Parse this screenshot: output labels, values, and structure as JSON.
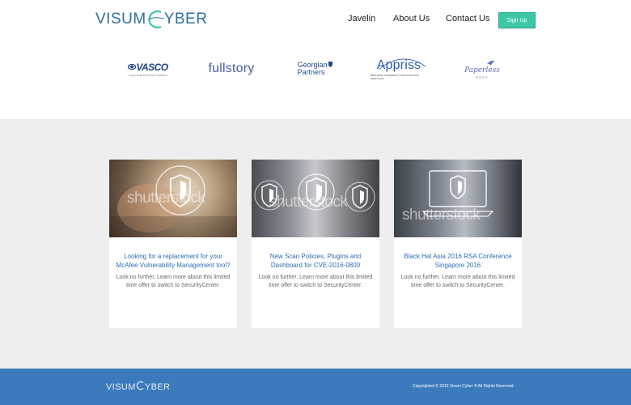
{
  "header": {
    "logo_text_left": "VISUM",
    "logo_text_right": "YBER",
    "nav": [
      {
        "label": "Javelin"
      },
      {
        "label": "About Us"
      },
      {
        "label": "Contact Us"
      }
    ],
    "signup_label": "Sign Up"
  },
  "partners": [
    {
      "name": "VASCO",
      "tagline": "THE AUTHENTICATION COMPANY"
    },
    {
      "name": "fullstory"
    },
    {
      "name_line1": "Georgian",
      "name_line2": "Partners"
    },
    {
      "name": "Appriss",
      "tagline": "REDUCING COMPLEXITY WITH DATA AND ANALYTICS"
    },
    {
      "name": "Paperless",
      "tagline": "POST"
    }
  ],
  "cards": [
    {
      "title": "Looking for a replacement for your McAfee Vulnerability Management tool?",
      "description": "Look no further. Learn more about this limited time offer to switch to SecurityCenter.",
      "watermark": "shutterstock"
    },
    {
      "title": "New Scan Policies, Plugins and Dashboard for CVE-2016-0800",
      "description": "Look no further. Learn more about this limited time offer to switch to SecurityCenter.",
      "watermark": "shutterstock"
    },
    {
      "title": "Black Hat Asia 2016 RSA Conference Singapore 2016",
      "description": "Look no further. Learn more about this limited time offer to switch to SecurityCenter.",
      "watermark": "shutterstock"
    }
  ],
  "footer": {
    "logo_text_left": "VISUM",
    "logo_text_right": "YBER",
    "copyright": "Copyrighted © 2016 Visum Cyber ® All Rights Reserved."
  },
  "colors": {
    "brand_blue": "#2f6fa5",
    "accent_teal": "#3cc7a6",
    "footer_blue": "#3a7abd",
    "link_blue": "#2f6db5"
  }
}
